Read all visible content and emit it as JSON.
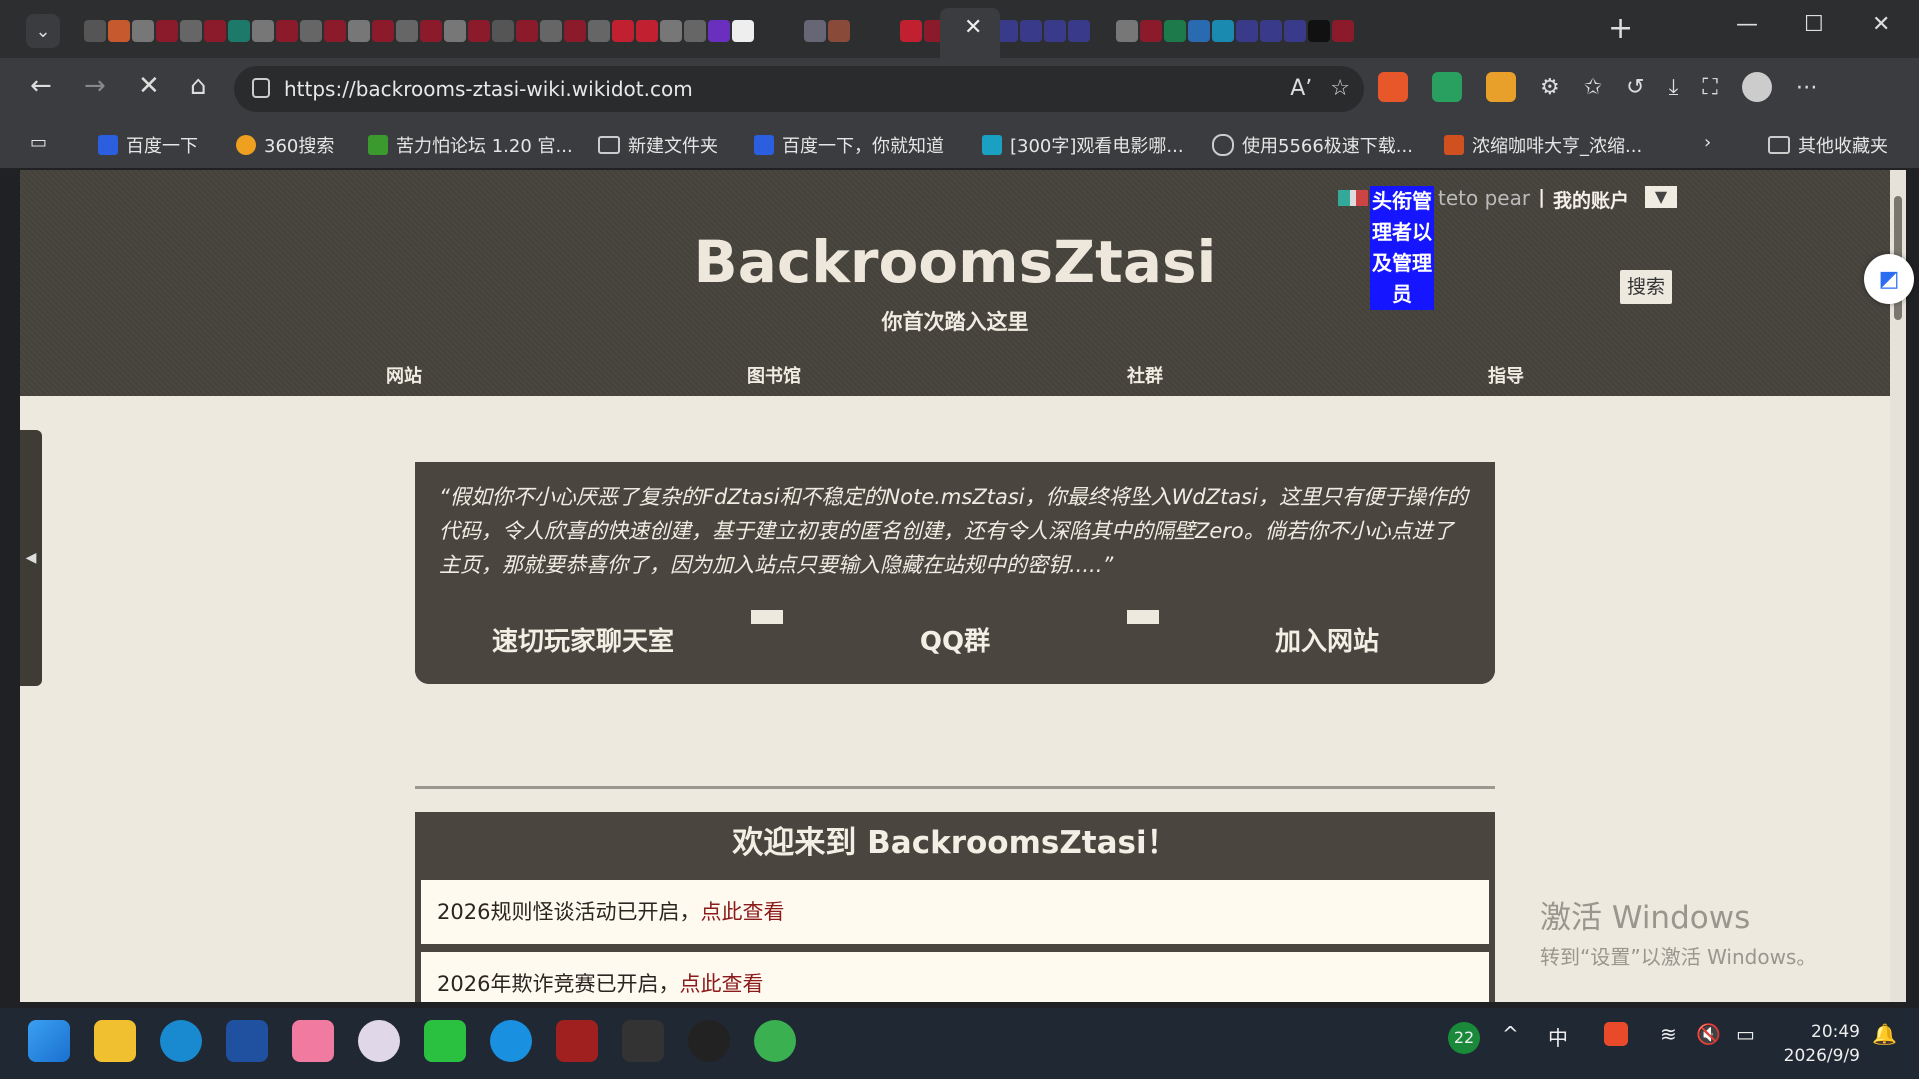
{
  "browser": {
    "tab_list_icon": "chevron-down-icon",
    "tab_close": "✕",
    "new_tab": "+",
    "url": "https://backrooms-ztasi-wiki.wikidot.com",
    "window_controls": [
      "—",
      "☐",
      "✕"
    ]
  },
  "bookmarks": [
    {
      "label": "百度一下",
      "color": "#2b5fe0"
    },
    {
      "label": "360搜索",
      "color": "#f0a020"
    },
    {
      "label": "苦力怕论坛 1.20 官...",
      "color": "#3b9a2e"
    },
    {
      "label": "新建文件夹",
      "color": "#cccccc"
    },
    {
      "label": "百度一下，你就知道",
      "color": "#2b5fe0"
    },
    {
      "label": "[300字]观看电影哪...",
      "color": "#1aa0c0"
    },
    {
      "label": "使用5566极速下载...",
      "color": "#cccccc"
    },
    {
      "label": "浓缩咖啡大亨_浓缩...",
      "color": "#d05020"
    },
    {
      "label": "其他收藏夹",
      "color": "#cccccc"
    }
  ],
  "site": {
    "title": "BackroomsZtasi",
    "subtitle": "你首次踏入这里",
    "nav": [
      "网站",
      "图书馆",
      "社群",
      "指导"
    ],
    "admin_badge": "头衔管理者以及管理员",
    "user_name": "teto pear",
    "separator": "|",
    "my_account": "我的账户",
    "dropdown": "▼",
    "search_label": "搜索",
    "side_toggle": "◀",
    "quote": "“假如你不小心厌恶了复杂的FdZtasi和不稳定的Note.msZtasi，你最终将坠入WdZtasi，这里只有便于操作的代码，令人欣喜的快速创建，基于建立初衷的匿名创建，还有令人深陷其中的隔壁Zero。倘若你不小心点进了主页，那就要恭喜你了，因为加入站点只要输入隐藏在站规中的密钥.....”",
    "buttons": [
      "速切玩家聊天室",
      "QQ群",
      "加入网站"
    ],
    "welcome": "欢迎来到 BackroomsZtasi！",
    "news": [
      {
        "text": "2026规则怪谈活动已开启，",
        "link": "点此查看"
      },
      {
        "text": "2026年欺诈竞赛已开启，",
        "link": "点此查看"
      }
    ]
  },
  "watermark": {
    "line1": "激活 Windows",
    "line2": "转到“设置”以激活 Windows。"
  },
  "taskbar": {
    "badge": "22",
    "ime": "中",
    "time": "20:49",
    "date": "2026/9/9"
  }
}
